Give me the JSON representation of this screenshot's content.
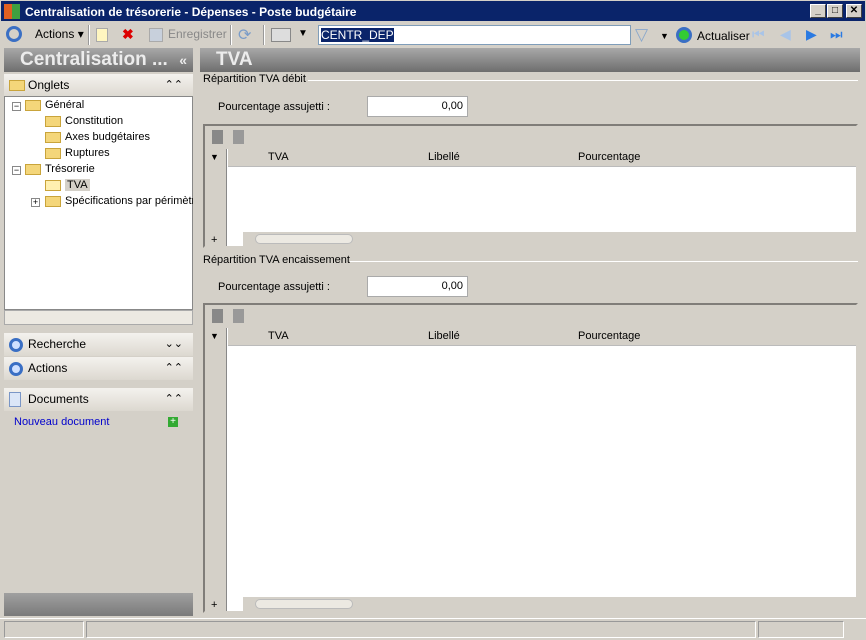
{
  "window": {
    "title": "Centralisation de trésorerie - Dépenses -  Poste budgétaire",
    "min": "_",
    "max": "□",
    "close": "✕"
  },
  "toolbar": {
    "actions": "Actions",
    "save": "Enregistrer",
    "search_value": "CENTR_DEP",
    "refresh": "Actualiser"
  },
  "left": {
    "header": "Centralisation ...",
    "collapse": "«",
    "onglets": "Onglets",
    "tree": [
      "Général",
      "Constitution",
      "Axes budgétaires",
      "Ruptures",
      "Trésorerie",
      "TVA",
      "Spécifications par périmètre"
    ],
    "recherche": "Recherche",
    "actions": "Actions",
    "documents": "Documents",
    "new_doc": "Nouveau document"
  },
  "main": {
    "header": "TVA",
    "section1": {
      "title": "Répartition TVA débit",
      "label": "Pourcentage assujetti :",
      "value": "0,00",
      "columns": [
        "TVA",
        "Libellé",
        "Pourcentage"
      ]
    },
    "section2": {
      "title": "Répartition TVA encaissement",
      "label": "Pourcentage assujetti :",
      "value": "0,00",
      "columns": [
        "TVA",
        "Libellé",
        "Pourcentage"
      ]
    }
  },
  "colors": {
    "titlebar": "#0a246a",
    "link": "#0000cc"
  }
}
